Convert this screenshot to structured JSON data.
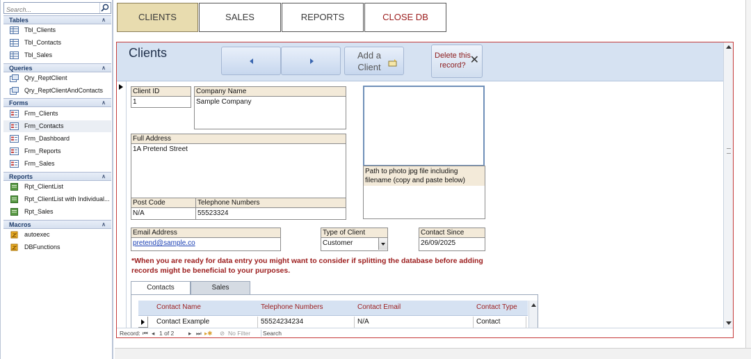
{
  "nav": {
    "search_placeholder": "Search...",
    "groups": [
      {
        "title": "Tables",
        "items": [
          "Tbl_Clients",
          "Tbl_Contacts",
          "Tbl_Sales"
        ]
      },
      {
        "title": "Queries",
        "items": [
          "Qry_ReptClient",
          "Qry_ReptClientAndContacts"
        ]
      },
      {
        "title": "Forms",
        "items": [
          "Frm_Clients",
          "Frm_Contacts",
          "Frm_Dashboard",
          "Frm_Reports",
          "Frm_Sales"
        ]
      },
      {
        "title": "Reports",
        "items": [
          "Rpt_ClientList",
          "Rpt_ClientList with Individual...",
          "Rpt_Sales"
        ]
      },
      {
        "title": "Macros",
        "items": [
          "autoexec",
          "DBFunctions"
        ]
      }
    ]
  },
  "top_buttons": [
    "CLIENTS",
    "SALES",
    "REPORTS",
    "CLOSE DB"
  ],
  "form": {
    "title": "Clients",
    "add_client": "Add a Client",
    "delete_record": "Delete this record?",
    "fields": {
      "client_id_label": "Client ID",
      "client_id": "1",
      "company_name_label": "Company Name",
      "company_name": "Sample Company",
      "full_address_label": "Full Address",
      "full_address": "1A Pretend Street",
      "post_code_label": "Post Code",
      "post_code": "N/A",
      "telephone_label": "Telephone Numbers",
      "telephone": "55523324",
      "photo_path_label": "Path to photo jpg file including filename (copy and paste below)",
      "email_label": "Email Address",
      "email": "pretend@sample.co",
      "client_type_label": "Type of Client",
      "client_type": "Customer",
      "contact_since_label": "Contact Since",
      "contact_since": "26/09/2025"
    },
    "note": "*When you are ready for data entry you might want to consider if splitting the database before adding records might be beneficial to your purposes.",
    "tabs": [
      "Contacts",
      "Sales"
    ],
    "contacts_table": {
      "headers": [
        "Contact Name",
        "Telephone Numbers",
        "Contact Email",
        "Contact Type"
      ],
      "rows": [
        [
          "Contact Example",
          "55524234234",
          "N/A",
          "Contact"
        ]
      ]
    },
    "record_nav": {
      "label": "Record:",
      "position": "1 of 2",
      "filter": "No Filter",
      "search": "Search"
    }
  },
  "colors": {
    "accent_tab": "#e8dcaf",
    "header_blue": "#d6e2f2",
    "label_beige": "#f3ead9",
    "warning_red": "#9b1c1c"
  }
}
